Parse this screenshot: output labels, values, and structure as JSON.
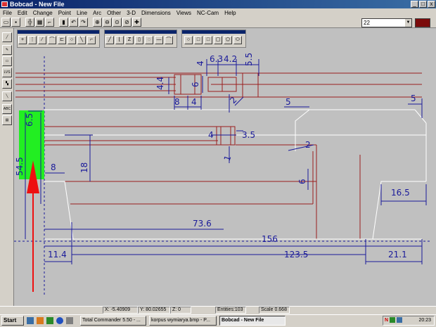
{
  "window": {
    "title": "Bobcad - New File",
    "min": "_",
    "max": "□",
    "close": "x"
  },
  "menu": [
    "File",
    "Edit",
    "Change",
    "Point",
    "Line",
    "Arc",
    "Other",
    "3-D",
    "Dimensions",
    "Views",
    "NC-Cam",
    "Help"
  ],
  "toolbar": {
    "layer_value": "22",
    "dropdown_arrow": "▼",
    "color": "#7b0b0b"
  },
  "drawing": {
    "dims": {
      "d_6_3": "6.3",
      "d_4_2": "4.2",
      "d_5_5": "5.5",
      "d_4_top": "4",
      "d_4_4": "4.4",
      "d_6_top": "6",
      "d_8_top": "8",
      "d_4_small": "4",
      "d_2_top": "2",
      "d_5_right": "5",
      "d_5_mid": "5",
      "d_6_5": "6.5",
      "d_4_mid": "4",
      "d_3_5": "3.5",
      "d_2_mid": "2",
      "d_1": "1",
      "d_54_5": "54.5",
      "d_8_mid": "8",
      "d_18": "18",
      "d_6_right": "6",
      "d_16_5": "16.5",
      "d_73_6": "73.6",
      "d_156": "156",
      "d_11_4": "11.4",
      "d_123_5": "123.5",
      "d_21_1": "21.1"
    },
    "colors": {
      "outline": "#9a1e1e",
      "dimension": "#1a1a9a",
      "highlight": "#22ee22",
      "arrow": "#ee1010",
      "background": "#c0c0c0"
    }
  },
  "status": {
    "x": "X: -5.40909",
    "y": "Y: 80.02655",
    "z": "Z: 0",
    "entities": "Entities:103",
    "scale": "Scale 0.668"
  },
  "taskbar": {
    "start": "Start",
    "tasks": [
      "Total Commander 5.50 - ...",
      "korpus wymiarya.bmp - P...",
      "Bobcad - New File"
    ],
    "tray_letter": "N",
    "clock": "20:23"
  }
}
